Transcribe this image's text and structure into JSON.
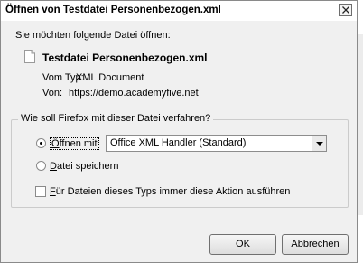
{
  "window": {
    "title": "Öffnen von Testdatei Personenbezogen.xml"
  },
  "intro": "Sie möchten folgende Datei öffnen:",
  "file": {
    "name": "Testdatei Personenbezogen.xml",
    "type_key": "Vom Typ:",
    "type_value": "XML Document",
    "from_key": "Von:",
    "from_value": "https://demo.academyfive.net",
    "icon": "document-icon"
  },
  "group": {
    "legend": "Wie soll Firefox mit dieser Datei verfahren?",
    "open_with": {
      "underlined": "Ö",
      "rest": "ffnen mit",
      "checked": true
    },
    "handler": {
      "selected": "Office XML Handler (Standard)"
    },
    "save_file": {
      "underlined": "D",
      "rest": "atei speichern",
      "checked": false
    },
    "always": {
      "underlined": "F",
      "rest": "ür Dateien dieses Typs immer diese Aktion ausführen",
      "checked": false
    }
  },
  "buttons": {
    "ok": "OK",
    "cancel": "Abbrechen"
  }
}
